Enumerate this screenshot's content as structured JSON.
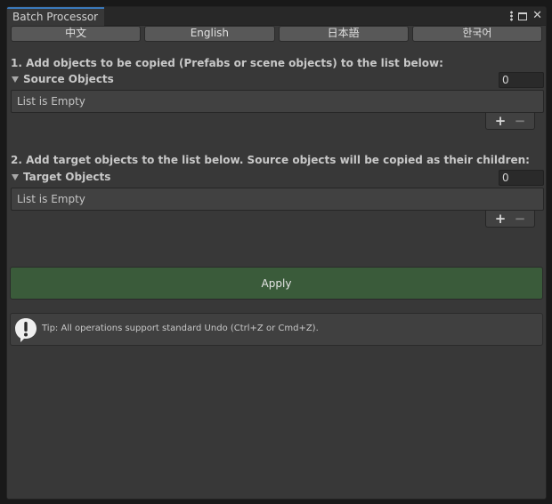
{
  "window": {
    "tab_title": "Batch Processor",
    "controls": {
      "menu_icon": "kebab-icon",
      "maximize_icon": "maximize-icon",
      "close_glyph": "✕"
    }
  },
  "languages": [
    "中文",
    "English",
    "日本語",
    "한국어"
  ],
  "source": {
    "instruction": "1. Add objects to be copied (Prefabs or scene objects) to the list below:",
    "title": "Source Objects",
    "size": "0",
    "empty_text": "List is Empty",
    "add_label": "+",
    "remove_label": "−"
  },
  "target": {
    "instruction": "2. Add target objects to the list below. Source objects will be copied as their children:",
    "title": "Target Objects",
    "size": "0",
    "empty_text": "List is Empty",
    "add_label": "+",
    "remove_label": "−"
  },
  "apply_label": "Apply",
  "tip": {
    "icon": "info-icon",
    "text": "Tip: All operations support standard Undo (Ctrl+Z or Cmd+Z)."
  },
  "colors": {
    "panel": "#383838",
    "apply": "#3a5b3a",
    "tab_accent": "#3a79bb"
  }
}
